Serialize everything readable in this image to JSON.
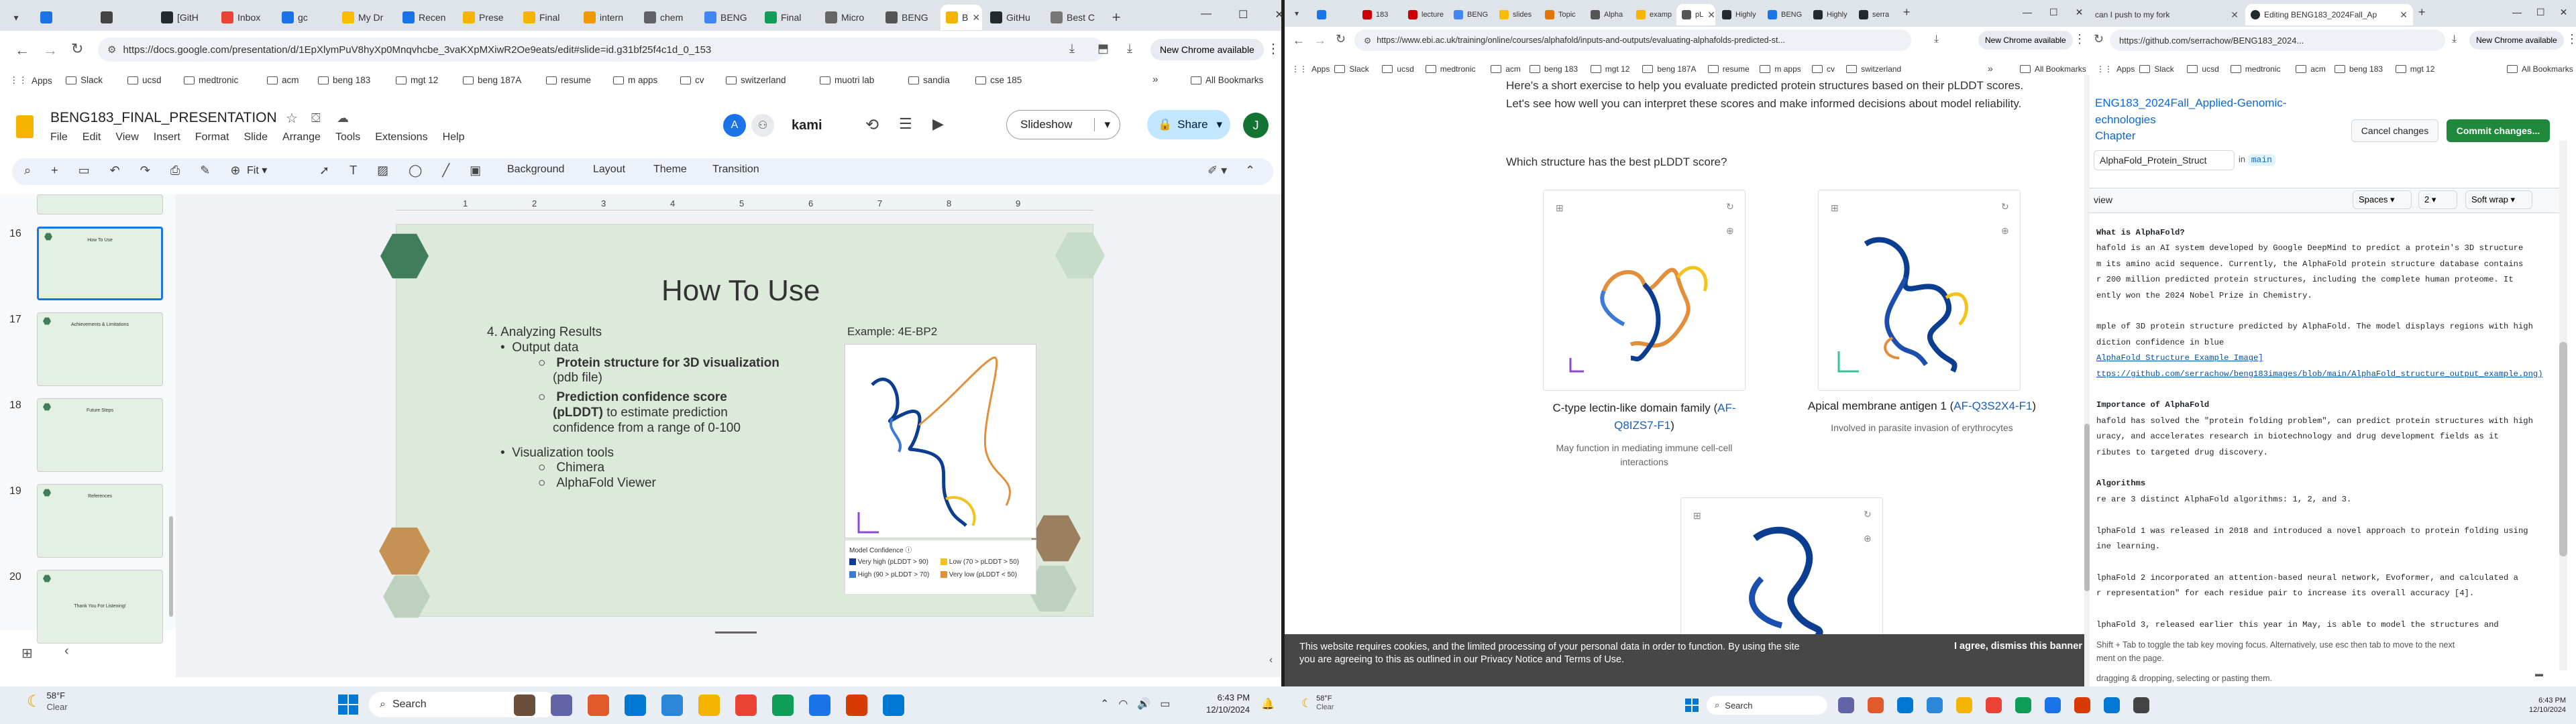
{
  "left_window": {
    "tabs": [
      {
        "label": "",
        "color": "#1a73e8"
      },
      {
        "label": "",
        "color": "#444"
      },
      {
        "label": "[GitH",
        "color": "#24292f"
      },
      {
        "label": "Inbox",
        "color": "#ea4335"
      },
      {
        "label": "gc",
        "color": "#1a73e8"
      },
      {
        "label": "My Dr",
        "color": "#fbbc04"
      },
      {
        "label": "Recen",
        "color": "#1a73e8"
      },
      {
        "label": "Prese",
        "color": "#f4b400"
      },
      {
        "label": "Final ",
        "color": "#f4b400"
      },
      {
        "label": "intern",
        "color": "#f29900"
      },
      {
        "label": "chem",
        "color": "#5f6368"
      },
      {
        "label": "BENG",
        "color": "#4285f4"
      },
      {
        "label": "Final ",
        "color": "#0f9d58"
      },
      {
        "label": "Micro",
        "color": "#666"
      },
      {
        "label": "BENG",
        "color": "#555"
      },
      {
        "label": "B",
        "color": "#f4b400"
      },
      {
        "label": "GitHu",
        "color": "#24292f"
      },
      {
        "label": "Best C",
        "color": "#777"
      }
    ],
    "url": "https://docs.google.com/presentation/d/1EpXlymPuV8hyXp0Mnqvhcbe_3vaKXpMXiwR2Oe9eats/edit#slide=id.g31bf25f4c1d_0_153",
    "update_label": "New Chrome available",
    "bookmarks": [
      "Apps",
      "Slack",
      "ucsd",
      "medtronic",
      "acm",
      "beng 183",
      "mgt 12",
      "beng 187A",
      "resume",
      "m apps",
      "cv",
      "switzerland",
      "muotri lab",
      "sandia",
      "cse 185"
    ],
    "all_bookmarks": "All Bookmarks",
    "doc_title": "BENG183_FINAL_PRESENTATION",
    "menu": [
      "File",
      "Edit",
      "View",
      "Insert",
      "Format",
      "Slide",
      "Arrange",
      "Tools",
      "Extensions",
      "Help"
    ],
    "kami": "kami",
    "slideshow": "Slideshow",
    "share": "Share",
    "user_initial": "J",
    "toolbar": {
      "zoom": "Fit",
      "background": "Background",
      "layout": "Layout",
      "theme": "Theme",
      "transition": "Transition"
    },
    "thumb_numbers": [
      "16",
      "17",
      "18",
      "19",
      "20"
    ],
    "thumb_titles": [
      "How To Use",
      "Achievements & Limitations",
      "Future Steps",
      "References",
      "Thank You For Listening!"
    ],
    "ruler": [
      "1",
      "2",
      "3",
      "4",
      "5",
      "6",
      "7",
      "8",
      "9"
    ],
    "slide": {
      "title": "How To Use",
      "heading": "4. Analyzing Results",
      "b1": "Output data",
      "b1a_bold": "Protein structure for 3D visualization",
      "b1a_rest": "(pdb file)",
      "b1b_bold1": "Prediction confidence score",
      "b1b_bold2": "(pLDDT)",
      "b1b_rest": " to estimate prediction confidence from a range of 0-100",
      "b2": "Visualization tools",
      "b2a": "Chimera",
      "b2b": "AlphaFold Viewer",
      "example": "Example: 4E-BP2",
      "legend_title": "Model Confidence ⓘ",
      "legend": [
        "Very high (pLDDT > 90)",
        "High (90 > pLDDT > 70)",
        "Low (70 > pLDDT > 50)",
        "Very low (pLDDT < 50)"
      ]
    }
  },
  "middle_window": {
    "tabs": [
      "",
      "183",
      "lecture",
      "BENG",
      "slides",
      "Topic",
      "Alpha",
      "examp",
      "pL",
      "Highly",
      "BENG",
      "Highly",
      "serra"
    ],
    "url": "https://www.ebi.ac.uk/training/online/courses/alphafold/inputs-and-outputs/evaluating-alphafolds-predicted-st...",
    "update_label": "New Chrome available",
    "bookmarks": [
      "Apps",
      "Slack",
      "ucsd",
      "medtronic",
      "acm",
      "beng 183",
      "mgt 12",
      "beng 187A",
      "resume",
      "m apps",
      "cv",
      "switzerland"
    ],
    "all_bookmarks": "All Bookmarks",
    "intro": "Here's a short exercise to help you evaluate predicted protein structures based on their pLDDT scores. Let's see how well you can interpret these scores and make informed decisions about model reliability.",
    "question": "Which structure has the best pLDDT score?",
    "cards": [
      {
        "name": "C-type lectin-like domain family",
        "code": "AF-Q8IZS7-F1",
        "desc": "May function in mediating immune cell-cell interactions"
      },
      {
        "name": "Apical membrane antigen 1",
        "code": "AF-Q3S2X4-F1",
        "desc": "Involved in parasite invasion of erythrocytes"
      }
    ],
    "cookie_text": "This website requires cookies, and the limited processing of your personal data in order to function. By using the site you are agreeing to this as outlined in our",
    "cookie_link1": "Privacy Notice",
    "cookie_and": " and ",
    "cookie_link2": "Terms of Use",
    "cookie_dismiss": "I agree, dismiss this banner"
  },
  "right_window": {
    "tabs": [
      "can I push to my fork",
      "Editing BENG183_2024Fall_Ap"
    ],
    "url": "https://github.com/serrachow/BENG183_2024...",
    "update_label": "New Chrome available",
    "bookmarks": [
      "Apps",
      "Slack",
      "ucsd",
      "medtronic",
      "acm",
      "beng 183",
      "mgt 12"
    ],
    "all_bookmarks": "All Bookmarks",
    "repo": "ENG183_2024Fall_Applied-Genomic-",
    "repo2": "echnologies",
    "chapter": "Chapter",
    "file": "AlphaFold_Protein_Struct",
    "branch": "main",
    "cancel": "Cancel changes",
    "commit": "Commit changes...",
    "view": "view",
    "spaces": "Spaces",
    "indent": "2",
    "wrap": "Soft wrap",
    "lines": [
      "What is AlphaFold?",
      "hafold is an AI system developed by Google DeepMind to predict a protein's 3D structure",
      "m its amino acid sequence. Currently, the AlphaFold protein structure database contains",
      "r 200 million predicted protein structures, including the complete human proteome. It",
      "ently won the 2024 Nobel Prize in Chemistry.",
      "",
      "mple of 3D protein structure predicted by AlphaFold. The model displays regions with high",
      "diction confidence in blue",
      "AlphaFold Structure Example Image]",
      "ttps://github.com/serrachow/beng183images/blob/main/AlphaFold_structure_output_example.png)",
      "",
      "Importance of AlphaFold",
      "hafold has solved the \"protein folding problem\", can predict protein structures with high",
      "uracy, and accelerates research in biotechnology and drug development fields as it",
      "ributes to targeted drug discovery.",
      "",
      "Algorithms",
      "re are 3 distinct AlphaFold algorithms: 1, 2, and 3.",
      "",
      "lphaFold 1 was released in 2018 and introduced a novel approach to protein folding using",
      "ine learning.",
      "",
      "lphaFold 2 incorporated an attention-based neural network, Evoformer, and calculated a",
      "r representation\" for each residue pair to increase its overall accuracy [4].",
      "",
      "lphaFold 3, released earlier this year in May, is able to model the structures and"
    ],
    "hint": "Shift + Tab to toggle the tab key moving focus. Alternatively, use esc then tab to move to the next",
    "hint2": "ment on the page.",
    "hint3": "dragging & dropping, selecting or pasting them."
  },
  "taskbar": {
    "weather_temp": "58°F",
    "weather_desc": "Clear",
    "search": "Search",
    "time": "6:43 PM",
    "date": "12/10/2024",
    "time2": "6:43 PM",
    "date2": "12/10/2024"
  }
}
